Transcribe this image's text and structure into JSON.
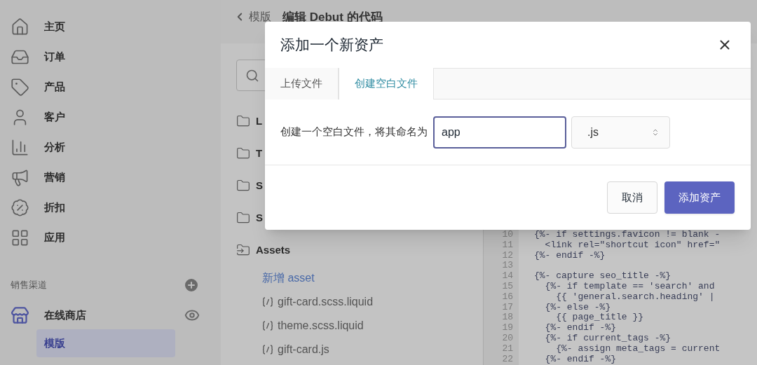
{
  "sidebar": {
    "items": [
      {
        "label": "主页",
        "selected": false
      },
      {
        "label": "订单",
        "selected": false
      },
      {
        "label": "产品",
        "selected": false
      },
      {
        "label": "客户",
        "selected": false
      },
      {
        "label": "分析",
        "selected": false
      },
      {
        "label": "营销",
        "selected": false
      },
      {
        "label": "折扣",
        "selected": false
      },
      {
        "label": "应用",
        "selected": false
      }
    ],
    "section_title": "销售渠道",
    "channel": {
      "label": "在线商店"
    },
    "sub_items": [
      {
        "label": "模版",
        "selected": true
      }
    ]
  },
  "header": {
    "back_link": "模版",
    "title": "编辑 Debut 的代码"
  },
  "file_tree": {
    "folders": [
      {
        "label": "L",
        "expanded": false
      },
      {
        "label": "T",
        "expanded": false
      },
      {
        "label": "S",
        "expanded": false
      },
      {
        "label": "S",
        "expanded": false
      },
      {
        "label": "Assets",
        "expanded": true,
        "children": [
          {
            "kind": "action",
            "label": "新增 asset"
          },
          {
            "kind": "file",
            "label": "gift-card.scss.liquid"
          },
          {
            "kind": "file",
            "label": "theme.scss.liquid"
          },
          {
            "kind": "file",
            "label": "gift-card.js"
          }
        ]
      }
    ]
  },
  "editor": {
    "lines": [
      {
        "number": "10",
        "code": "{%- if settings.favicon != blank -"
      },
      {
        "number": "11",
        "code": "  <link rel=\"shortcut icon\" href=\""
      },
      {
        "number": "12",
        "code": "{%- endif -%}"
      },
      {
        "number": "13"
      },
      {
        "number": "14",
        "code": "{%- capture seo_title -%}"
      },
      {
        "number": "15",
        "code": "  {%- if template == 'search' and"
      },
      {
        "number": "16",
        "code": "    {{ 'general.search.heading' |"
      },
      {
        "number": "17",
        "code": "  {%- else -%}"
      },
      {
        "number": "18",
        "code": "    {{ page_title }}"
      },
      {
        "number": "19",
        "code": "  {%- endif -%}"
      },
      {
        "number": "20",
        "code": "  {%- if current_tags -%}"
      },
      {
        "number": "21",
        "code": "    {%- assign meta_tags = current"
      },
      {
        "number": "22",
        "code": "  {%- endif -%}"
      }
    ]
  },
  "modal": {
    "title": "添加一个新资产",
    "tabs": [
      {
        "label": "上传文件",
        "selected": false
      },
      {
        "label": "创建空白文件",
        "selected": true
      }
    ],
    "prompt": "创建一个空白文件，将其命名为",
    "name_field": {
      "value": "app"
    },
    "extension_select": {
      "value": ".js"
    },
    "buttons": [
      {
        "label": "取消",
        "kind": "secondary"
      },
      {
        "label": "添加资产",
        "kind": "primary"
      }
    ]
  }
}
